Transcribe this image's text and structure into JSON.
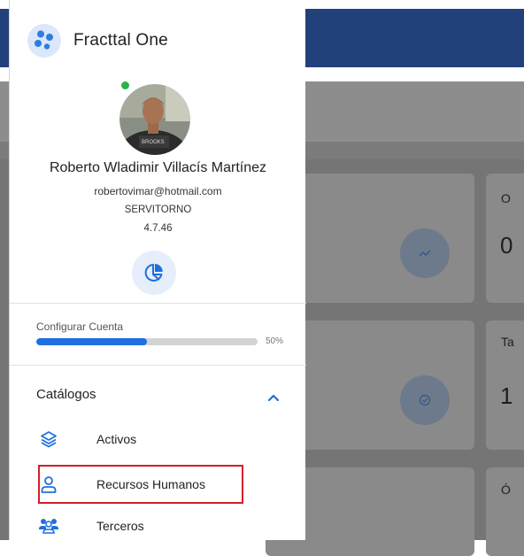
{
  "app": {
    "name": "Fracttal One"
  },
  "user": {
    "name": "Roberto Wladimir Villacís Martínez",
    "email": "robertovimar@hotmail.com",
    "company": "SERVITORNO",
    "version": "4.7.46",
    "status": "online"
  },
  "account": {
    "label": "Configurar Cuenta",
    "progress_percent": 50,
    "progress_text": "50%"
  },
  "catalog": {
    "title": "Catálogos",
    "expanded": true,
    "items": [
      {
        "label": "Activos",
        "icon": "layers-icon"
      },
      {
        "label": "Recursos Humanos",
        "icon": "person-icon"
      },
      {
        "label": "Terceros",
        "icon": "group-icon"
      }
    ]
  },
  "background": {
    "cards": [
      {
        "text": "O"
      },
      {
        "text": "0"
      },
      {
        "text": "Ta"
      },
      {
        "text": "1"
      },
      {
        "text": "Ó"
      }
    ]
  },
  "colors": {
    "accent": "#1f6fe0",
    "topbar": "#22417a",
    "highlight": "#d21f2a",
    "online": "#2bb24c"
  }
}
